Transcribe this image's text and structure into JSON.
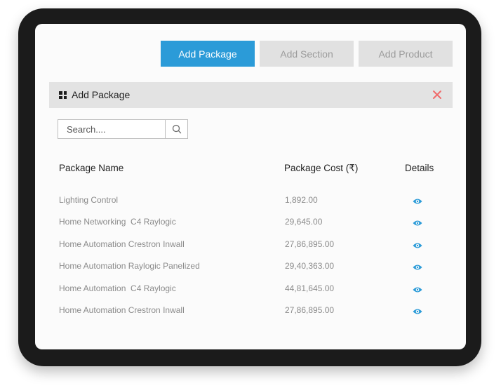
{
  "toolbar": {
    "add_package": "Add Package",
    "add_section": "Add Section",
    "add_product": "Add Product"
  },
  "panel": {
    "title": "Add Package",
    "icon": "grid-icon",
    "close_icon": "close-icon",
    "close_color": "#f06b6b"
  },
  "search": {
    "placeholder": "Search....",
    "value": "",
    "icon": "search-icon"
  },
  "table": {
    "headers": {
      "name": "Package Name",
      "cost": "Package Cost (₹)",
      "details": "Details"
    },
    "rows": [
      {
        "name": "Lighting Control",
        "cost": "1,892.00",
        "details_icon": "eye-icon"
      },
      {
        "name": "Home Networking  C4 Raylogic",
        "cost": "29,645.00",
        "details_icon": "eye-icon"
      },
      {
        "name": "Home Automation Crestron Inwall",
        "cost": "27,86,895.00",
        "details_icon": "eye-icon"
      },
      {
        "name": "Home Automation Raylogic Panelized",
        "cost": "29,40,363.00",
        "details_icon": "eye-icon"
      },
      {
        "name": "Home Automation  C4 Raylogic",
        "cost": "44,81,645.00",
        "details_icon": "eye-icon"
      },
      {
        "name": "Home Automation Crestron Inwall",
        "cost": "27,86,895.00",
        "details_icon": "eye-icon"
      }
    ]
  },
  "colors": {
    "accent": "#2b9bd8",
    "inactive_button": "#e1e1e1",
    "eye_icon": "#2b9bd8"
  }
}
